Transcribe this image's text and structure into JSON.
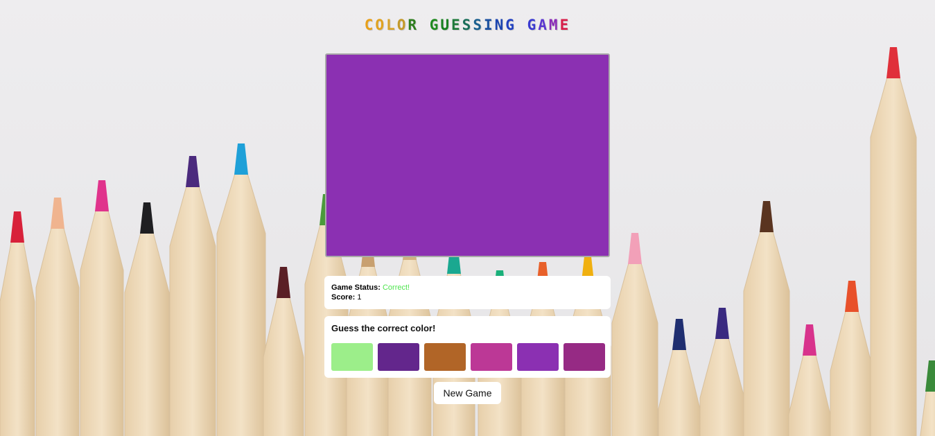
{
  "title": {
    "letters": [
      {
        "ch": "C",
        "color": "#e8a01a"
      },
      {
        "ch": "O",
        "color": "#e0a21f"
      },
      {
        "ch": "L",
        "color": "#d8a32a"
      },
      {
        "ch": "O",
        "color": "#c49a2a"
      },
      {
        "ch": "R",
        "color": "#2e7d1e"
      },
      {
        "ch": " ",
        "color": "#000000"
      },
      {
        "ch": "G",
        "color": "#1f8a1f"
      },
      {
        "ch": "U",
        "color": "#17801f"
      },
      {
        "ch": "E",
        "color": "#1e7a3a"
      },
      {
        "ch": "S",
        "color": "#1a6e5a"
      },
      {
        "ch": "S",
        "color": "#1a5e8e"
      },
      {
        "ch": "I",
        "color": "#1a4fa0"
      },
      {
        "ch": "N",
        "color": "#1b44b0"
      },
      {
        "ch": "G",
        "color": "#2140c0"
      },
      {
        "ch": " ",
        "color": "#000000"
      },
      {
        "ch": "G",
        "color": "#3a3ad0"
      },
      {
        "ch": "A",
        "color": "#5a36d0"
      },
      {
        "ch": "M",
        "color": "#8a2cb8"
      },
      {
        "ch": "E",
        "color": "#d81e4a"
      }
    ]
  },
  "display": {
    "color": "#8b30b2"
  },
  "status": {
    "label": "Game Status:",
    "value": "Correct!",
    "value_color": "#4ee44e",
    "score_label": "Score:",
    "score_value": "1"
  },
  "guess": {
    "label": "Guess the correct color!",
    "options": [
      {
        "color": "#9cee8a"
      },
      {
        "color": "#63268c"
      },
      {
        "color": "#b16527"
      },
      {
        "color": "#bc3896"
      },
      {
        "color": "#8b30b2"
      },
      {
        "color": "#962a84"
      }
    ]
  },
  "new_game_label": "New Game"
}
